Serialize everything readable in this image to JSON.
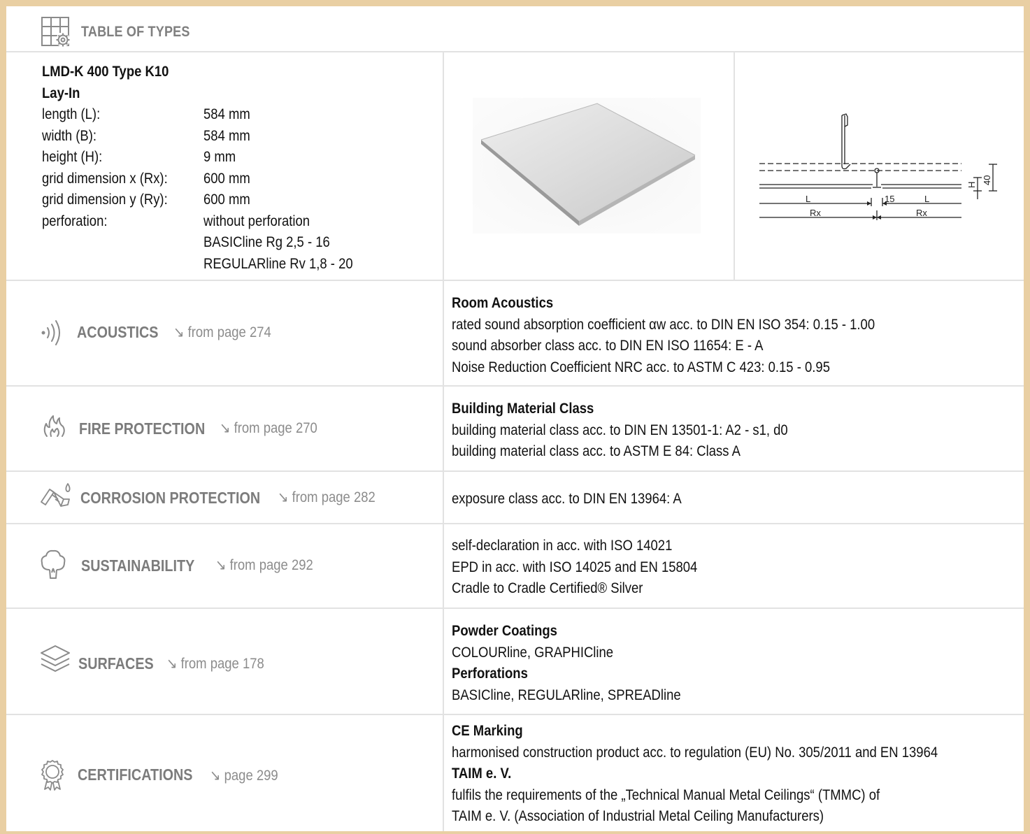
{
  "header": {
    "title": "TABLE OF TYPES",
    "icon": "grid-settings-icon"
  },
  "product": {
    "name": "LMD-K 400 Type K10",
    "subtitle": "Lay-In",
    "specs": [
      {
        "label": "length (L):",
        "value": "584 mm"
      },
      {
        "label": "width (B):",
        "value": "584 mm"
      },
      {
        "label": "height (H):",
        "value": "9 mm"
      },
      {
        "label": "grid dimension x (Rx):",
        "value": "600 mm"
      },
      {
        "label": "grid dimension y (Ry):",
        "value": "600 mm"
      },
      {
        "label": "perforation:",
        "value": "without perforation"
      },
      {
        "label": "",
        "value": "BASICline Rg 2,5 - 16"
      },
      {
        "label": "",
        "value": "REGULARline Rv 1,8 - 20"
      }
    ]
  },
  "drawing": {
    "L": "L",
    "Rx": "Rx",
    "gap": "15",
    "H": "H",
    "height": "40"
  },
  "sections": [
    {
      "label": "ACOUSTICS",
      "page_ref": "↘ from page 274",
      "icon": "sound-waves-icon",
      "lines": [
        {
          "text": "Room Acoustics",
          "bold": true
        },
        {
          "text": "rated sound absorption coefficient αw acc. to DIN EN ISO 354: 0.15 - 1.00",
          "bold": false
        },
        {
          "text": "sound absorber class acc. to DIN EN ISO 11654: E - A",
          "bold": false
        },
        {
          "text": "Noise Reduction Coefficient NRC acc. to ASTM C 423: 0.15 - 0.95",
          "bold": false
        }
      ]
    },
    {
      "label": "FIRE PROTECTION",
      "page_ref": "↘ from page 270",
      "icon": "flame-icon",
      "lines": [
        {
          "text": "Building Material Class",
          "bold": true
        },
        {
          "text": "building material class acc. to DIN EN 13501-1: A2 - s1, d0",
          "bold": false
        },
        {
          "text": "building material class acc. to ASTM E 84: Class A",
          "bold": false
        }
      ]
    },
    {
      "label": "CORROSION PROTECTION",
      "page_ref": "↘ from page 282",
      "icon": "corrosion-icon",
      "lines": [
        {
          "text": "exposure class acc. to DIN EN 13964: A",
          "bold": false
        }
      ]
    },
    {
      "label": "SUSTAINABILITY",
      "page_ref": "↘ from page 292",
      "icon": "tree-icon",
      "lines": [
        {
          "text": "self-declaration in acc. with ISO 14021",
          "bold": false
        },
        {
          "text": "EPD in acc. with ISO 14025 and EN 15804",
          "bold": false
        },
        {
          "text": "Cradle to Cradle Certified® Silver",
          "bold": false
        }
      ]
    },
    {
      "label": "SURFACES",
      "page_ref": "↘ from page 178",
      "icon": "layers-icon",
      "lines": [
        {
          "text": "Powder Coatings",
          "bold": true
        },
        {
          "text": "COLOURline, GRAPHICline",
          "bold": false
        },
        {
          "text": "Perforations",
          "bold": true
        },
        {
          "text": "BASICline, REGULARline, SPREADline",
          "bold": false
        }
      ]
    },
    {
      "label": "CERTIFICATIONS",
      "page_ref": "↘ page 299",
      "icon": "award-rosette-icon",
      "lines": [
        {
          "text": "CE Marking",
          "bold": true
        },
        {
          "text": "harmonised construction product acc. to regulation (EU) No. 305/2011 and EN 13964",
          "bold": false
        },
        {
          "text": "TAIM e. V.",
          "bold": true
        },
        {
          "text": "fulfils the requirements of the „Technical Manual Metal Ceilings“ (TMMC) of",
          "bold": false
        },
        {
          "text": "TAIM e. V. (Association of Industrial Metal Ceiling Manufacturers)",
          "bold": false
        }
      ]
    }
  ],
  "colors": {
    "frame": "#e9cfa3",
    "grid_lines": "#e2e2e2",
    "label_gray": "#7c7c7c"
  }
}
